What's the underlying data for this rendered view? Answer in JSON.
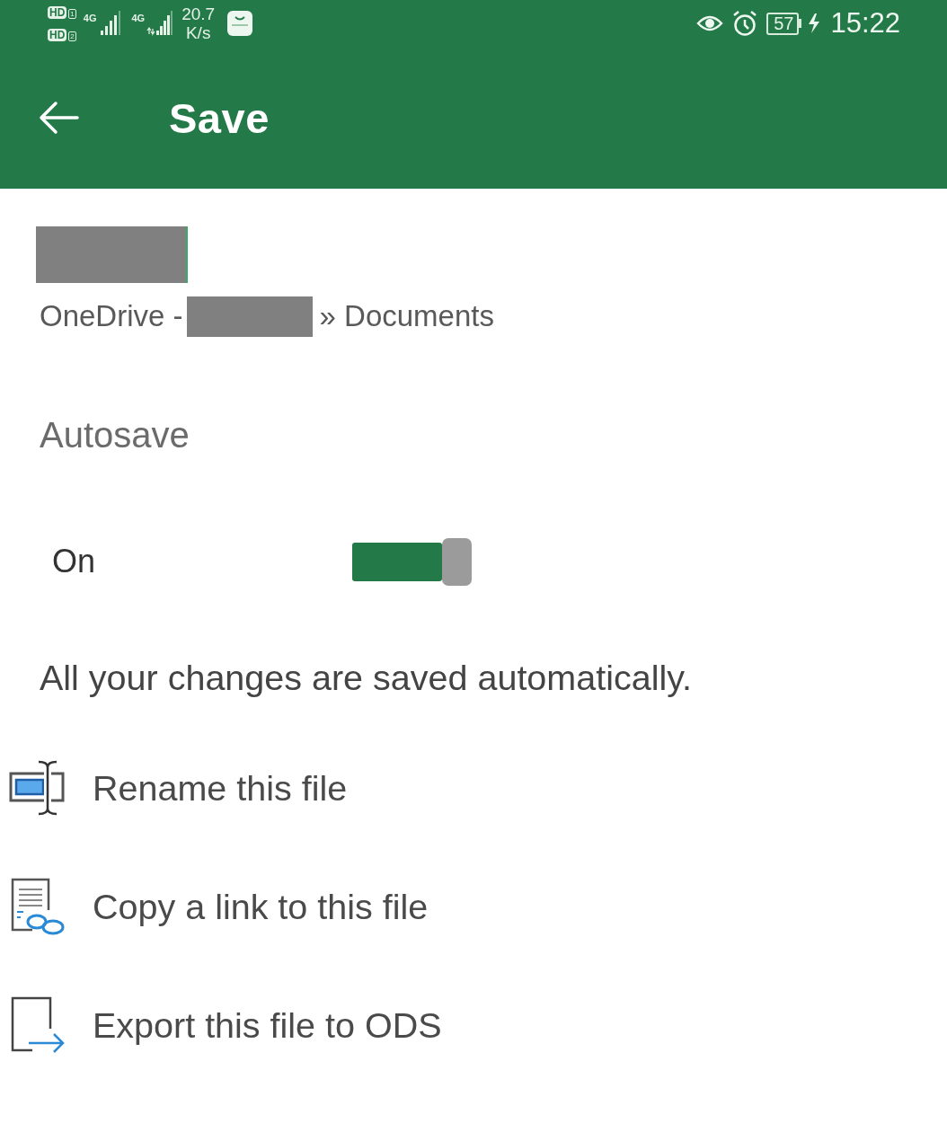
{
  "status_bar": {
    "sims": [
      {
        "badge": "HD",
        "slot": "1"
      },
      {
        "badge": "HD",
        "slot": "2"
      }
    ],
    "networks": [
      "4G",
      "4G"
    ],
    "speed": {
      "value": "20.7",
      "unit": "K/s"
    },
    "battery": "57",
    "time": "15:22"
  },
  "toolbar": {
    "title": "Save"
  },
  "location": {
    "prefix": "OneDrive -",
    "suffix": "» Documents"
  },
  "autosave": {
    "heading": "Autosave",
    "label": "On",
    "on": true,
    "description": "All your changes are saved automatically."
  },
  "actions": [
    {
      "kind": "rename",
      "label": "Rename this file"
    },
    {
      "kind": "link",
      "label": "Copy a link to this file"
    },
    {
      "kind": "export",
      "label": "Export this file to ODS"
    }
  ]
}
